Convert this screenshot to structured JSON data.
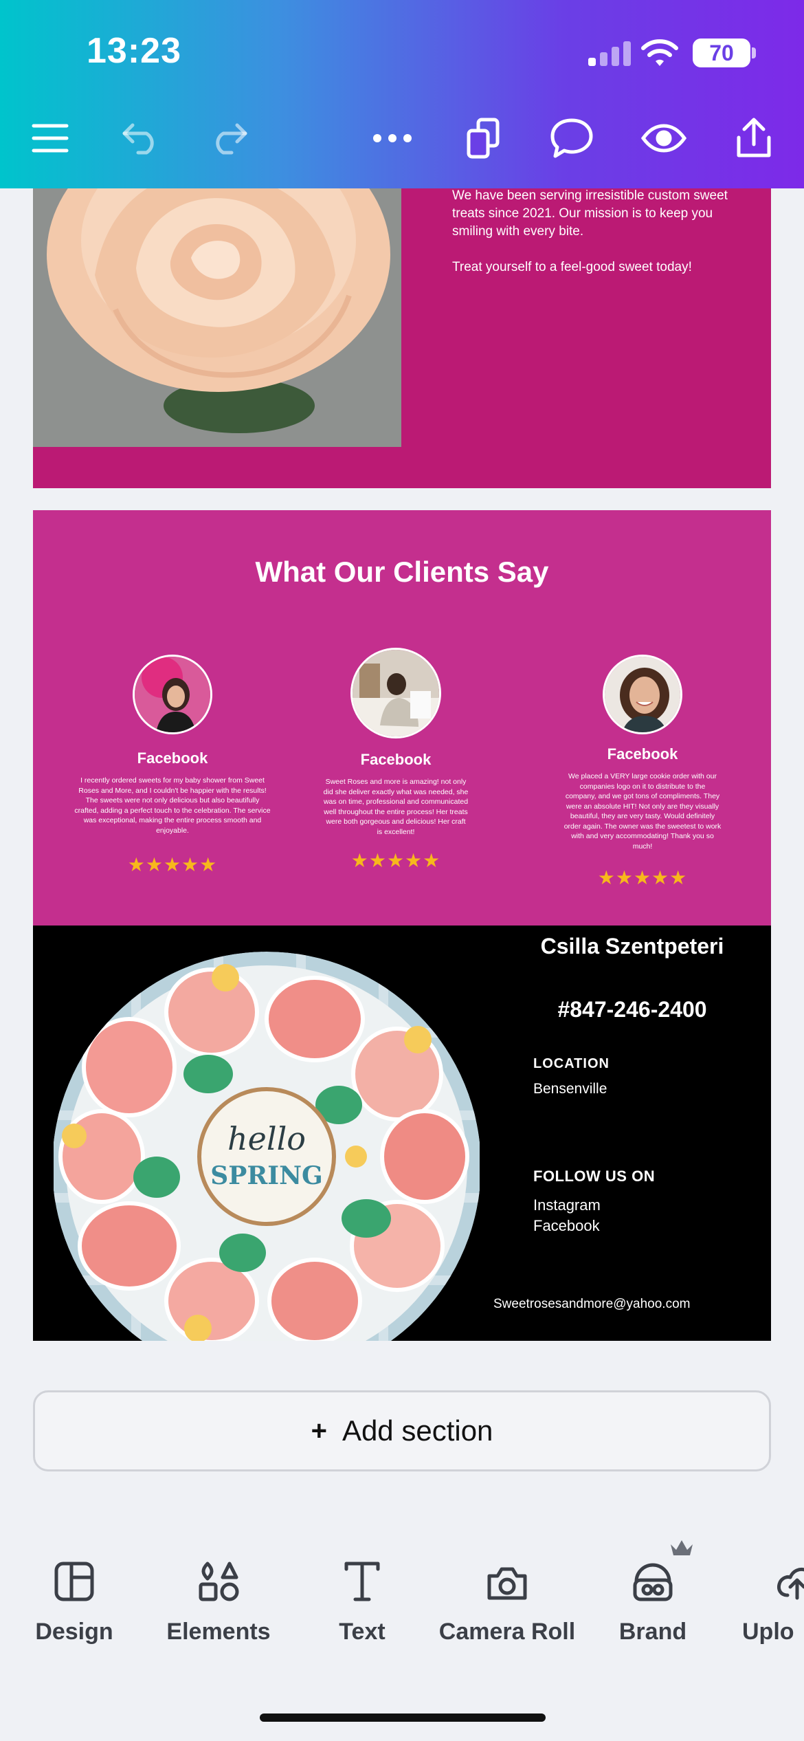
{
  "status_bar": {
    "time": "13:23",
    "battery": "70"
  },
  "about": {
    "paragraph1": "We have been serving irresistible custom sweet treats since 2021. Our mission is to keep you smiling with every bite.",
    "paragraph2": "Treat yourself to a feel-good sweet today!"
  },
  "testimonials": {
    "title": "What Our Clients Say",
    "reviews": [
      {
        "source": "Facebook",
        "rating": 5,
        "stars": "★★★★★",
        "text": "I recently ordered sweets for my baby shower from Sweet Roses and More, and I couldn't be happier with the results! The sweets were not only delicious but also beautifully crafted, adding a perfect touch to the celebration. The service was exceptional, making the entire process smooth and enjoyable."
      },
      {
        "source": "Facebook",
        "rating": 5,
        "stars": "★★★★★",
        "text": "Sweet Roses and more is amazing! not only did she deliver exactly what was needed, she was on time, professional and communicated well throughout the entire process! Her treats were both gorgeous and delicious! Her craft is excellent!"
      },
      {
        "source": "Facebook",
        "rating": 5,
        "stars": "★★★★★",
        "text": "We placed a VERY large cookie order with our companies logo on it to distribute to the company, and we got tons of compliments. They were an absolute HIT! Not only are they visually beautiful, they are very tasty. Would definitely order again. The owner was the sweetest to work with and very accommodating! Thank you so much!"
      }
    ]
  },
  "cookies": {
    "plaque_line1": "hello",
    "plaque_line2": "SPRING"
  },
  "contact": {
    "name": "Csilla Szentpeteri",
    "phone": "#847-246-2400",
    "location_label": "LOCATION",
    "location_value": "Bensenville",
    "follow_label": "FOLLOW US ON",
    "social1": "Instagram",
    "social2": "Facebook",
    "email": "Sweetrosesandmore@yahoo.com"
  },
  "add_section": {
    "plus": "+",
    "label": "Add section"
  },
  "bottom_tools": {
    "design": "Design",
    "elements": "Elements",
    "text": "Text",
    "camera_roll": "Camera Roll",
    "brand": "Brand",
    "uploads": "Uplo"
  },
  "colors": {
    "header_gradient_start": "#00c4cc",
    "header_gradient_end": "#7d2ae8",
    "about_bg": "#bb1a74",
    "testimonials_bg": "#c42f8e",
    "star": "#f7b81c",
    "brand_crown": "#6b6f78"
  }
}
